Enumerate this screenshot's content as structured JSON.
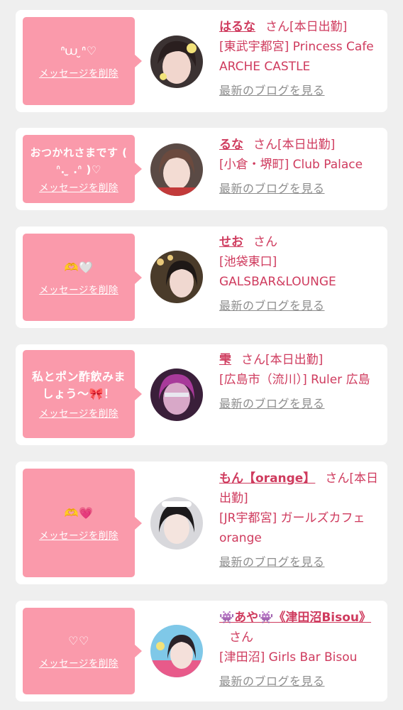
{
  "cards": [
    {
      "message": "ᐢ⩊ ̮ᐢ♡",
      "delete_label": "メッセージを削除",
      "name": "はるな",
      "san": "さん",
      "status": "[本日出勤]",
      "shop": "[東武宇都宮] Princess Cafe ARCHE CASTLE",
      "blog_label": "最新のブログを見る"
    },
    {
      "message": "おつかれさまです ( ᐢ. ̫ .ᐢ )♡",
      "delete_label": "メッセージを削除",
      "name": "るな",
      "san": "さん",
      "status": "[本日出勤]",
      "shop": "[小倉・堺町] Club Palace",
      "blog_label": "最新のブログを見る"
    },
    {
      "message": "🫶🤍",
      "delete_label": "メッセージを削除",
      "name": "せお",
      "san": "さん",
      "status": "",
      "shop": "[池袋東口] GALSBAR&LOUNGE",
      "blog_label": "最新のブログを見る"
    },
    {
      "message": "私とポン酢飲みましょう〜🎀！",
      "delete_label": "メッセージを削除",
      "name": "雫",
      "san": "さん",
      "status": "[本日出勤]",
      "shop": "[広島市（流川）] Ruler 広島",
      "blog_label": "最新のブログを見る"
    },
    {
      "message": "🫶💗",
      "delete_label": "メッセージを削除",
      "name": "もん【orange】",
      "san": "さん",
      "status": "[本日出勤]",
      "shop": "[JR宇都宮] ガールズカフェ orange",
      "blog_label": "最新のブログを見る"
    },
    {
      "message": "♡♡",
      "delete_label": "メッセージを削除",
      "name": "👾あや👾《津田沼Bisou》",
      "san": "さん",
      "status": "",
      "shop": "[津田沼] Girls Bar Bisou",
      "blog_label": "最新のブログを見る"
    }
  ]
}
